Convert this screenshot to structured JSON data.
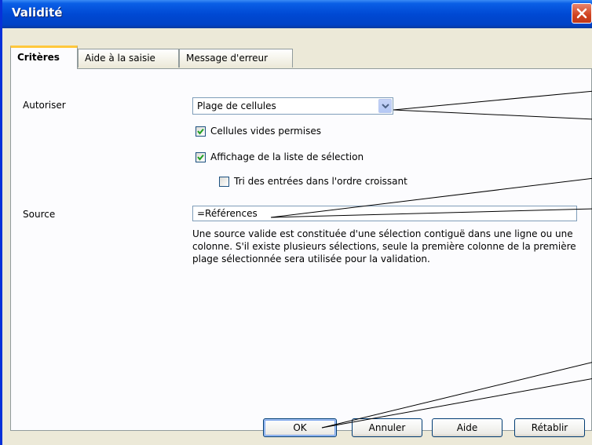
{
  "window": {
    "title": "Validité"
  },
  "tabs": [
    {
      "label": "Critères",
      "active": true
    },
    {
      "label": "Aide à la saisie",
      "active": false
    },
    {
      "label": "Message d'erreur",
      "active": false
    }
  ],
  "criteria": {
    "allow_label": "Autoriser",
    "allow_value": "Plage de cellules",
    "checkboxes": [
      {
        "label": "Cellules vides permises",
        "checked": true
      },
      {
        "label": "Affichage de la liste de sélection",
        "checked": true
      },
      {
        "label": "Tri des entrées dans l'ordre croissant",
        "checked": false
      }
    ],
    "source_label": "Source",
    "source_value": "=Références",
    "help_text": "Une source valide est constituée d'une sélection contiguë dans une ligne ou une colonne. S'il existe plusieurs sélections, seule la première colonne de la première plage sélectionnée sera utilisée pour la validation."
  },
  "buttons": {
    "ok": "OK",
    "cancel": "Annuler",
    "help": "Aide",
    "reset": "Rétablir"
  },
  "colors": {
    "title_bar": "#0049d4",
    "dialog_bg": "#ece9d8",
    "tab_highlight": "#ffc83c",
    "check": "#21a121"
  },
  "icons": {
    "close": "close-icon",
    "dropdown": "chevron-down-icon",
    "check": "checkmark-icon"
  }
}
